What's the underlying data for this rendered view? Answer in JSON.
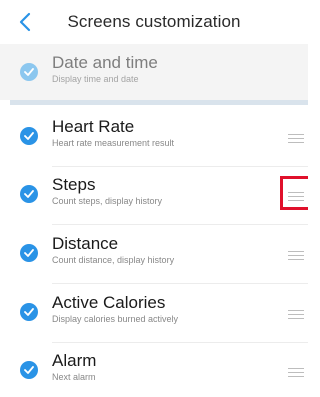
{
  "header": {
    "title": "Screens customization",
    "back_icon": "chevron-left-icon",
    "accent": "#2a93e6"
  },
  "fixed_item": {
    "label": "Date and time",
    "subtitle": "Display time and date",
    "checked": true
  },
  "items": [
    {
      "label": "Heart Rate",
      "subtitle": "Heart rate measurement result",
      "checked": true
    },
    {
      "label": "Steps",
      "subtitle": "Count steps, display history",
      "checked": true
    },
    {
      "label": "Distance",
      "subtitle": "Count distance, display history",
      "checked": true
    },
    {
      "label": "Active Calories",
      "subtitle": "Display calories burned actively",
      "checked": true
    },
    {
      "label": "Alarm",
      "subtitle": "Next alarm",
      "checked": true
    }
  ],
  "colors": {
    "check_active": "#2a93e6",
    "check_fixed": "#8cc7ef",
    "highlight": "#e0102b",
    "divider": "#d9e3ec"
  }
}
